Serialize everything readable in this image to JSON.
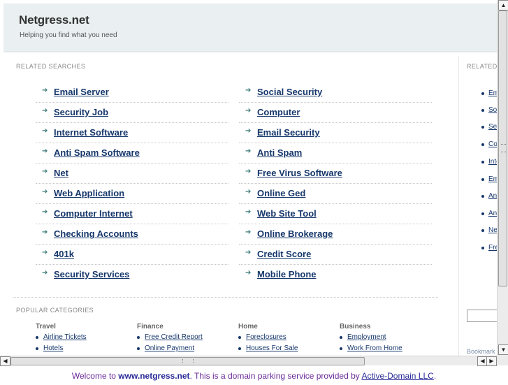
{
  "header": {
    "title": "Netgress.net",
    "tagline": "Helping you find what you need"
  },
  "related": {
    "heading": "RELATED SEARCHES",
    "left": [
      "Email Server",
      "Security Job",
      "Internet Software",
      "Anti Spam Software",
      "Net",
      "Web Application",
      "Computer Internet",
      "Checking Accounts",
      "401k",
      "Security Services"
    ],
    "right": [
      "Social Security",
      "Computer",
      "Email Security",
      "Anti Spam",
      "Free Virus Software",
      "Online Ged",
      "Web Site Tool",
      "Online Brokerage",
      "Credit Score",
      "Mobile Phone"
    ]
  },
  "categories": {
    "heading": "POPULAR CATEGORIES",
    "groups": [
      {
        "title": "Travel",
        "items": [
          "Airline Tickets",
          "Hotels"
        ]
      },
      {
        "title": "Finance",
        "items": [
          "Free Credit Report",
          "Online Payment"
        ]
      },
      {
        "title": "Home",
        "items": [
          "Foreclosures",
          "Houses For Sale"
        ]
      },
      {
        "title": "Business",
        "items": [
          "Employment",
          "Work From Home"
        ]
      }
    ]
  },
  "side": {
    "heading": "RELATED",
    "items": [
      "Em",
      "Soc",
      "Sec",
      "Co",
      "Inte",
      "Em",
      "Ant",
      "Ant",
      "Ne",
      "Fre"
    ],
    "bookmark": "Bookmark"
  },
  "footer": {
    "prefix": "Welcome to ",
    "domain": "www.netgress.net",
    "middle": ". This is a domain parking service provided by ",
    "provider": "Active-Domain LLC",
    "suffix": "."
  },
  "icons": {
    "arrow": "arrow-right-icon",
    "bullet": "bullet-icon"
  },
  "colors": {
    "link": "#16376b",
    "header_bg": "#eaf0f2",
    "arrow": "#3a7a78",
    "footer_text": "#6a2a9a"
  }
}
